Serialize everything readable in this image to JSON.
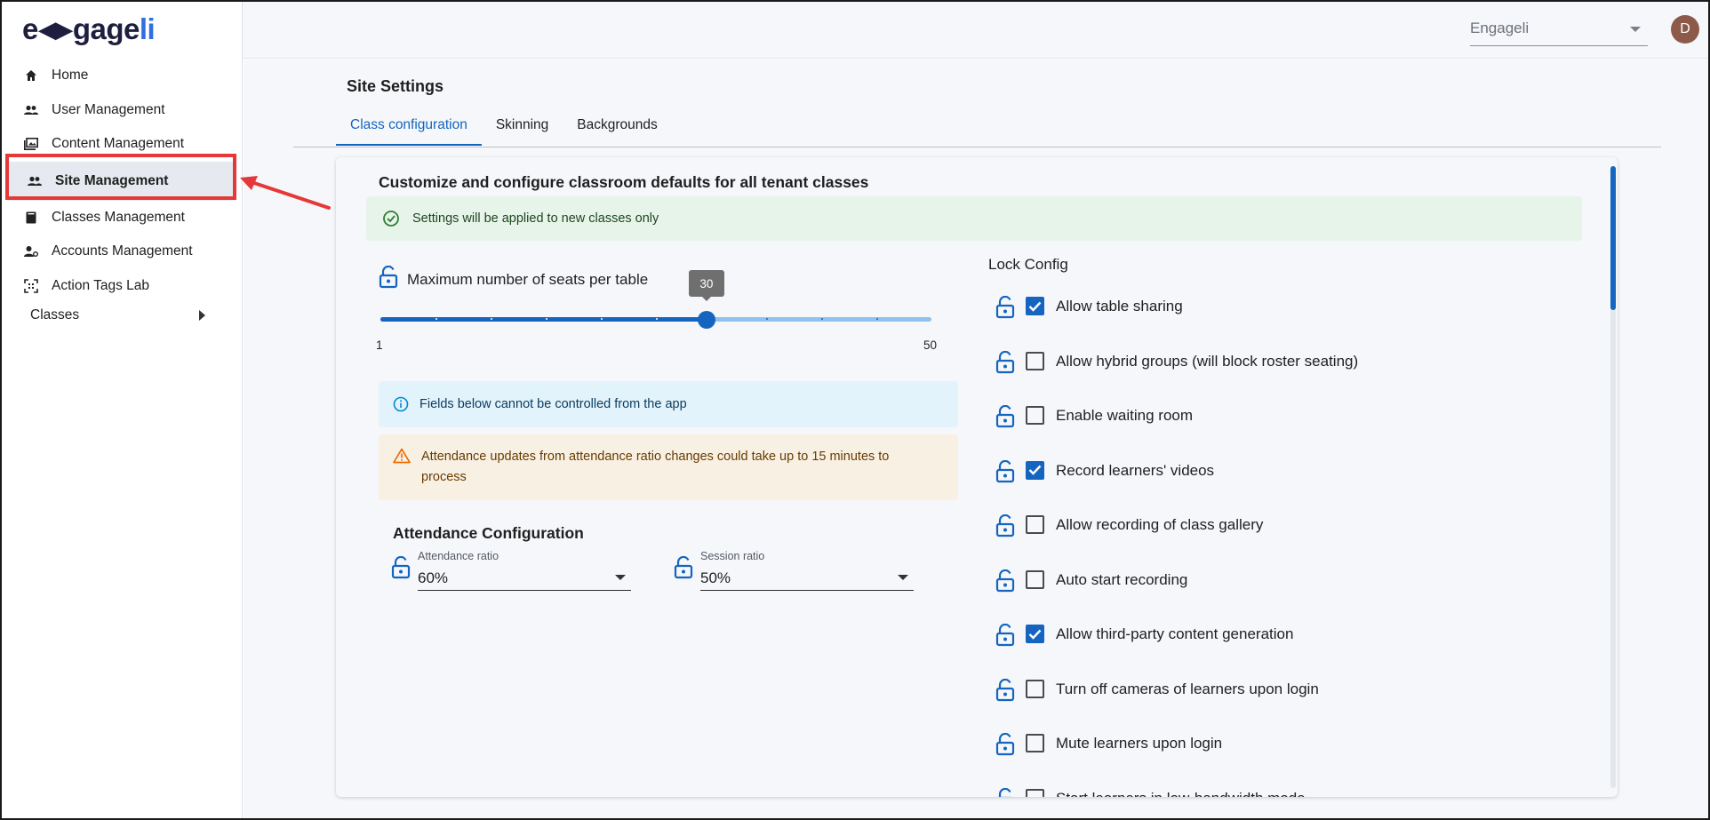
{
  "app": {
    "logo_prefix": "e",
    "logo_main": "gage",
    "logo_suffix": "li",
    "tenant_select": "Engageli",
    "avatar_initial": "D",
    "accent_color": "#1565c0"
  },
  "sidebar": {
    "items": [
      {
        "label": "Home",
        "icon": "home-icon"
      },
      {
        "label": "User Management",
        "icon": "people-icon"
      },
      {
        "label": "Content Management",
        "icon": "photo-library-icon"
      },
      {
        "label": "Site Management",
        "icon": "people-icon",
        "active": true
      },
      {
        "label": "Classes Management",
        "icon": "book-icon"
      },
      {
        "label": "Accounts Management",
        "icon": "account-settings-icon"
      },
      {
        "label": "Action Tags Lab",
        "icon": "scan-icon"
      }
    ],
    "classes_label": "Classes"
  },
  "page": {
    "title": "Site Settings",
    "tabs": [
      "Class configuration",
      "Skinning",
      "Backgrounds"
    ],
    "active_tab": 0
  },
  "card": {
    "title": "Customize and configure classroom defaults for all tenant classes",
    "success_alert": "Settings will be applied to new classes only",
    "seats_label": "Maximum number of seats per table",
    "slider": {
      "min": 1,
      "max": 50,
      "value": 30,
      "min_label": "1",
      "max_label": "50",
      "value_label": "30",
      "ticks": 10
    },
    "info_alert": "Fields below cannot be controlled from the app",
    "warning_alert": "Attendance updates from attendance ratio changes could take up to 15 minutes to process",
    "attendance": {
      "title": "Attendance Configuration",
      "attendance_ratio_label": "Attendance ratio",
      "attendance_ratio_value": "60%",
      "session_ratio_label": "Session ratio",
      "session_ratio_value": "50%"
    },
    "lock_config": {
      "title": "Lock Config",
      "items": [
        {
          "label": "Allow table sharing",
          "checked": true
        },
        {
          "label": "Allow hybrid groups (will block roster seating)",
          "checked": false
        },
        {
          "label": "Enable waiting room",
          "checked": false
        },
        {
          "label": "Record learners' videos",
          "checked": true
        },
        {
          "label": "Allow recording of class gallery",
          "checked": false
        },
        {
          "label": "Auto start recording",
          "checked": false
        },
        {
          "label": "Allow third-party content generation",
          "checked": true
        },
        {
          "label": "Turn off cameras of learners upon login",
          "checked": false
        },
        {
          "label": "Mute learners upon login",
          "checked": false
        },
        {
          "label": "Start learners in low-bandwidth mode",
          "checked": false
        }
      ]
    }
  }
}
